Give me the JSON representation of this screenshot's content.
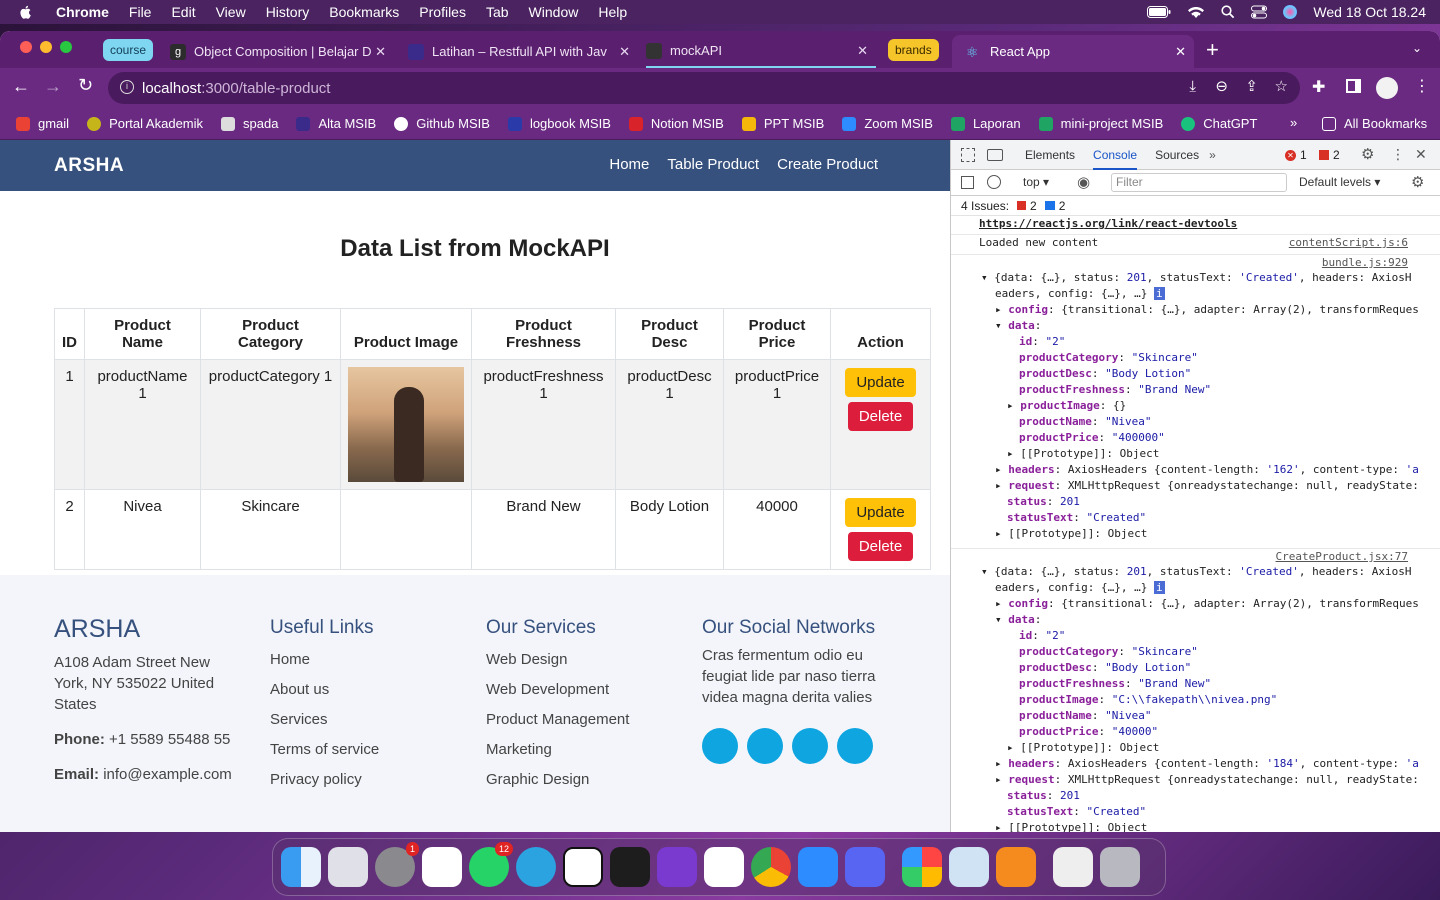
{
  "menubar": {
    "app": "Chrome",
    "items": [
      "File",
      "Edit",
      "View",
      "History",
      "Bookmarks",
      "Profiles",
      "Tab",
      "Window",
      "Help"
    ],
    "clock": "Wed 18 Oct  18.24"
  },
  "tabs": [
    {
      "group": "course",
      "label": "Object Composition | Belajar D"
    },
    {
      "label": "Latihan – Restfull API with Jav"
    },
    {
      "label": "mockAPI"
    },
    {
      "group": "brands",
      "label": "React App"
    }
  ],
  "address": {
    "host": "localhost",
    "path": ":3000/table-product"
  },
  "bookmarks": [
    "gmail",
    "Portal Akademik",
    "spada",
    "Alta MSIB",
    "Github MSIB",
    "logbook MSIB",
    "Notion MSIB",
    "PPT MSIB",
    "Zoom MSIB",
    "Laporan",
    "mini-project MSIB",
    "ChatGPT"
  ],
  "all_bookmarks": "All Bookmarks",
  "site": {
    "brand": "ARSHA",
    "nav": [
      "Home",
      "Table Product",
      "Create Product"
    ],
    "heading": "Data List from MockAPI",
    "columns": [
      "ID",
      "Product Name",
      "Product Category",
      "Product Image",
      "Product Freshness",
      "Product Desc",
      "Product Price",
      "Action"
    ],
    "rows": [
      {
        "id": "1",
        "name": "productName 1",
        "category": "productCategory 1",
        "freshness": "productFreshness 1",
        "desc": "productDesc 1",
        "price": "productPrice 1"
      },
      {
        "id": "2",
        "name": "Nivea",
        "category": "Skincare",
        "freshness": "Brand New",
        "desc": "Body Lotion",
        "price": "40000"
      }
    ],
    "update_label": "Update",
    "delete_label": "Delete",
    "footer": {
      "brand": "ARSHA",
      "address": "A108 Adam Street New York, NY 535022 United States",
      "phone_label": "Phone:",
      "phone": "+1 5589 55488 55",
      "email_label": "Email:",
      "email": "info@example.com",
      "useful_title": "Useful Links",
      "useful": [
        "Home",
        "About us",
        "Services",
        "Terms of service",
        "Privacy policy"
      ],
      "services_title": "Our Services",
      "services": [
        "Web Design",
        "Web Development",
        "Product Management",
        "Marketing",
        "Graphic Design"
      ],
      "social_title": "Our Social Networks",
      "social_text": "Cras fermentum odio eu feugiat lide par naso tierra videa magna derita valies"
    }
  },
  "devtools": {
    "tabs": [
      "Elements",
      "Console",
      "Sources"
    ],
    "errors": "1",
    "warnings": "2",
    "context": "top",
    "filter_placeholder": "Filter",
    "levels": "Default levels",
    "issues_label": "4 Issues:",
    "issues_err": "2",
    "issues_info": "2",
    "lines": {
      "devtools_link": "https://reactjs.org/link/react-devtools",
      "loaded": "Loaded new content",
      "src1": "contentScript.js:6",
      "src2": "bundle.js:929",
      "src3": "CreateProduct.jsx:77"
    }
  },
  "dock_badges": {
    "settings": "1",
    "whatsapp": "12"
  }
}
